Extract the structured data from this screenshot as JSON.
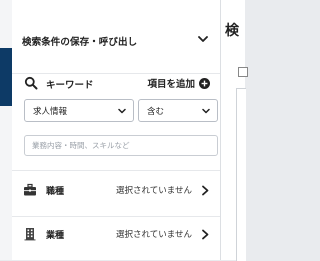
{
  "panel": {
    "title": "検索条件の保存・呼び出し",
    "keyword": {
      "label": "キーワード",
      "add_label": "項目を追加",
      "field_select": "求人情報",
      "match_select": "含む",
      "input_value": "",
      "input_placeholder": "業務内容・時間、スキルなど"
    },
    "rows": [
      {
        "label": "職種",
        "status": "選択されていません",
        "icon": "briefcase-icon"
      },
      {
        "label": "業種",
        "status": "選択されていません",
        "icon": "building-icon"
      }
    ]
  },
  "right_panel": {
    "title_fragment": "検"
  },
  "colors": {
    "accent_navy": "#0d3a66",
    "border": "#b9bec6"
  }
}
